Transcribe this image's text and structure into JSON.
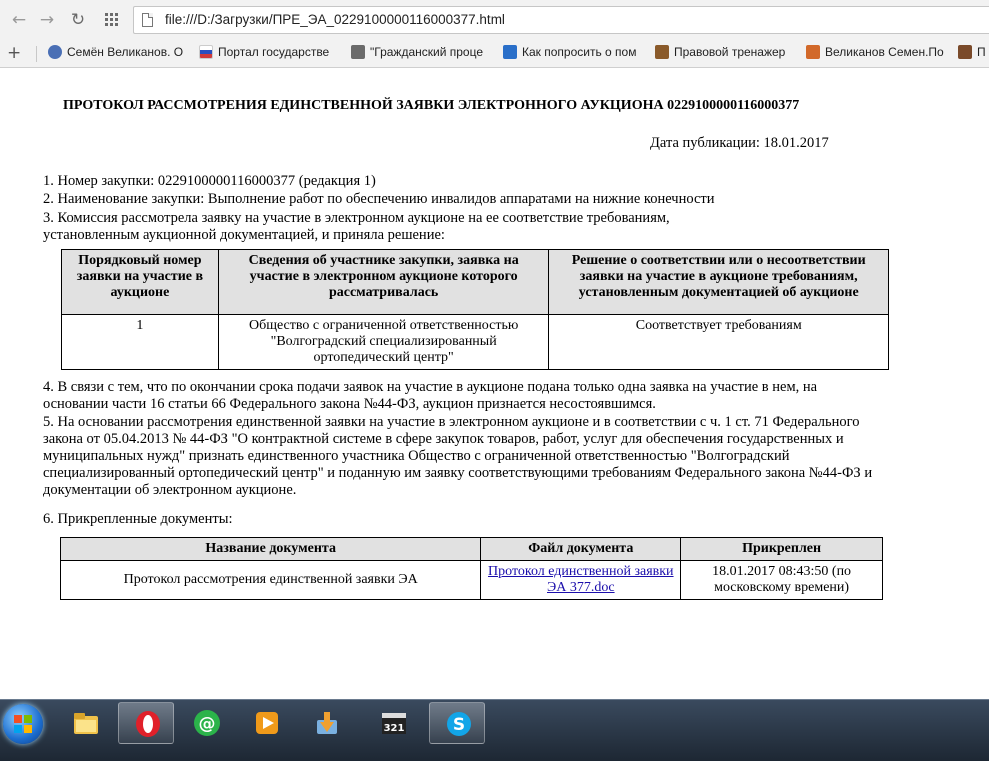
{
  "browser": {
    "back_icon": "arrow-left-icon",
    "forward_icon": "arrow-right-icon",
    "reload_icon": "reload-icon",
    "apps_icon": "apps-grid-icon",
    "url": "file:///D:/Загрузки/ПРЕ_ЭА_0229100000116000377.html"
  },
  "bookmarks": [
    {
      "label": "Семён Великанов. О",
      "color": "#4a6fb5"
    },
    {
      "label": "Портал государстве",
      "color": "#d03a3a"
    },
    {
      "label": "\"Гражданский проце",
      "color": "#6a6a6a"
    },
    {
      "label": "Как попросить о пом",
      "color": "#2a6fc9"
    },
    {
      "label": "Правовой тренажер",
      "color": "#8a5a2a"
    },
    {
      "label": "Великанов Семен.По",
      "color": "#d2692a"
    },
    {
      "label": "П",
      "color": "#7a4a2a"
    }
  ],
  "document": {
    "title": "ПРОТОКОЛ РАССМОТРЕНИЯ ЕДИНСТВЕННОЙ ЗАЯВКИ ЭЛЕКТРОННОГО АУКЦИОНА 0229100000116000377",
    "publication_date": "Дата публикации: 18.01.2017",
    "item1": "1. Номер закупки: 0229100000116000377 (редакция 1)",
    "item2": "2. Наименование закупки: Выполнение работ по обеспечению инвалидов аппаратами на нижние конечности",
    "item3_line1": "3. Комиссия рассмотрела заявку на участие в электронном аукционе на ее соответствие требованиям,",
    "item3_line2": "установленным аукционной документацией, и приняла решение:",
    "decision_table": {
      "headers": [
        "Порядковый номер заявки на участие в аукционе",
        "Сведения об участнике закупки, заявка на участие в электронном аукционе которого рассматривалась",
        "Решение о соответствии или о несоответствии заявки на участие в аукционе требованиям, установленным документацией об аукционе"
      ],
      "rows": [
        [
          "1",
          "Общество с ограниченной ответственностью \"Волгоградский специализированный ортопедический центр\"",
          "Соответствует требованиям"
        ]
      ]
    },
    "item4": "4. В связи с тем, что по окончании срока подачи заявок на участие в аукционе подана только одна заявка на участие в нем, на основании части 16 статьи 66 Федерального закона №44-ФЗ, аукцион признается несостоявшимся.",
    "item5": "5. На основании рассмотрения единственной заявки на участие в электронном аукционе и в соответствии с ч. 1 ст. 71 Федерального закона от 05.04.2013 № 44-ФЗ \"О контрактной системе в сфере закупок товаров, работ, услуг для обеспечения государственных и муниципальных нужд\" признать единственного участника Общество с ограниченной ответственностью \"Волгоградский специализированный ортопедический центр\" и поданную им заявку соответствующими требованиям Федерального закона №44-ФЗ и документации об электронном аукционе.",
    "item6": "6. Прикрепленные документы:",
    "attachments_table": {
      "headers": [
        "Название документа",
        "Файл документа",
        "Прикреплен"
      ],
      "rows": [
        [
          "Протокол рассмотрения единственной заявки ЭА",
          "Протокол единственной заявки ЭА 377.doc",
          "18.01.2017 08:43:50 (по московскому времени)"
        ]
      ]
    }
  },
  "taskbar": {
    "start_icon": "windows-start-icon",
    "apps": [
      {
        "icon": "file-explorer-icon",
        "active": false
      },
      {
        "icon": "opera-icon",
        "active": true
      },
      {
        "icon": "mail-agent-icon",
        "active": false
      },
      {
        "icon": "media-player-icon",
        "active": false
      },
      {
        "icon": "downloader-icon",
        "active": false
      },
      {
        "icon": "media-classic-icon",
        "active": false
      },
      {
        "icon": "skype-icon",
        "active": true
      }
    ]
  }
}
